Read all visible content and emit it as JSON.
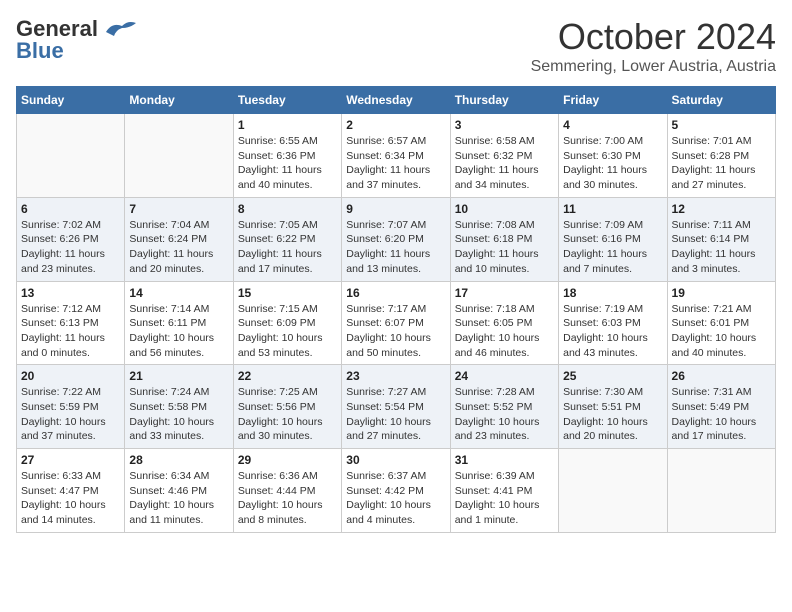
{
  "header": {
    "logo_line1": "General",
    "logo_line2": "Blue",
    "title": "October 2024",
    "subtitle": "Semmering, Lower Austria, Austria"
  },
  "weekdays": [
    "Sunday",
    "Monday",
    "Tuesday",
    "Wednesday",
    "Thursday",
    "Friday",
    "Saturday"
  ],
  "weeks": [
    [
      {
        "day": "",
        "info": ""
      },
      {
        "day": "",
        "info": ""
      },
      {
        "day": "1",
        "info": "Sunrise: 6:55 AM\nSunset: 6:36 PM\nDaylight: 11 hours and 40 minutes."
      },
      {
        "day": "2",
        "info": "Sunrise: 6:57 AM\nSunset: 6:34 PM\nDaylight: 11 hours and 37 minutes."
      },
      {
        "day": "3",
        "info": "Sunrise: 6:58 AM\nSunset: 6:32 PM\nDaylight: 11 hours and 34 minutes."
      },
      {
        "day": "4",
        "info": "Sunrise: 7:00 AM\nSunset: 6:30 PM\nDaylight: 11 hours and 30 minutes."
      },
      {
        "day": "5",
        "info": "Sunrise: 7:01 AM\nSunset: 6:28 PM\nDaylight: 11 hours and 27 minutes."
      }
    ],
    [
      {
        "day": "6",
        "info": "Sunrise: 7:02 AM\nSunset: 6:26 PM\nDaylight: 11 hours and 23 minutes."
      },
      {
        "day": "7",
        "info": "Sunrise: 7:04 AM\nSunset: 6:24 PM\nDaylight: 11 hours and 20 minutes."
      },
      {
        "day": "8",
        "info": "Sunrise: 7:05 AM\nSunset: 6:22 PM\nDaylight: 11 hours and 17 minutes."
      },
      {
        "day": "9",
        "info": "Sunrise: 7:07 AM\nSunset: 6:20 PM\nDaylight: 11 hours and 13 minutes."
      },
      {
        "day": "10",
        "info": "Sunrise: 7:08 AM\nSunset: 6:18 PM\nDaylight: 11 hours and 10 minutes."
      },
      {
        "day": "11",
        "info": "Sunrise: 7:09 AM\nSunset: 6:16 PM\nDaylight: 11 hours and 7 minutes."
      },
      {
        "day": "12",
        "info": "Sunrise: 7:11 AM\nSunset: 6:14 PM\nDaylight: 11 hours and 3 minutes."
      }
    ],
    [
      {
        "day": "13",
        "info": "Sunrise: 7:12 AM\nSunset: 6:13 PM\nDaylight: 11 hours and 0 minutes."
      },
      {
        "day": "14",
        "info": "Sunrise: 7:14 AM\nSunset: 6:11 PM\nDaylight: 10 hours and 56 minutes."
      },
      {
        "day": "15",
        "info": "Sunrise: 7:15 AM\nSunset: 6:09 PM\nDaylight: 10 hours and 53 minutes."
      },
      {
        "day": "16",
        "info": "Sunrise: 7:17 AM\nSunset: 6:07 PM\nDaylight: 10 hours and 50 minutes."
      },
      {
        "day": "17",
        "info": "Sunrise: 7:18 AM\nSunset: 6:05 PM\nDaylight: 10 hours and 46 minutes."
      },
      {
        "day": "18",
        "info": "Sunrise: 7:19 AM\nSunset: 6:03 PM\nDaylight: 10 hours and 43 minutes."
      },
      {
        "day": "19",
        "info": "Sunrise: 7:21 AM\nSunset: 6:01 PM\nDaylight: 10 hours and 40 minutes."
      }
    ],
    [
      {
        "day": "20",
        "info": "Sunrise: 7:22 AM\nSunset: 5:59 PM\nDaylight: 10 hours and 37 minutes."
      },
      {
        "day": "21",
        "info": "Sunrise: 7:24 AM\nSunset: 5:58 PM\nDaylight: 10 hours and 33 minutes."
      },
      {
        "day": "22",
        "info": "Sunrise: 7:25 AM\nSunset: 5:56 PM\nDaylight: 10 hours and 30 minutes."
      },
      {
        "day": "23",
        "info": "Sunrise: 7:27 AM\nSunset: 5:54 PM\nDaylight: 10 hours and 27 minutes."
      },
      {
        "day": "24",
        "info": "Sunrise: 7:28 AM\nSunset: 5:52 PM\nDaylight: 10 hours and 23 minutes."
      },
      {
        "day": "25",
        "info": "Sunrise: 7:30 AM\nSunset: 5:51 PM\nDaylight: 10 hours and 20 minutes."
      },
      {
        "day": "26",
        "info": "Sunrise: 7:31 AM\nSunset: 5:49 PM\nDaylight: 10 hours and 17 minutes."
      }
    ],
    [
      {
        "day": "27",
        "info": "Sunrise: 6:33 AM\nSunset: 4:47 PM\nDaylight: 10 hours and 14 minutes."
      },
      {
        "day": "28",
        "info": "Sunrise: 6:34 AM\nSunset: 4:46 PM\nDaylight: 10 hours and 11 minutes."
      },
      {
        "day": "29",
        "info": "Sunrise: 6:36 AM\nSunset: 4:44 PM\nDaylight: 10 hours and 8 minutes."
      },
      {
        "day": "30",
        "info": "Sunrise: 6:37 AM\nSunset: 4:42 PM\nDaylight: 10 hours and 4 minutes."
      },
      {
        "day": "31",
        "info": "Sunrise: 6:39 AM\nSunset: 4:41 PM\nDaylight: 10 hours and 1 minute."
      },
      {
        "day": "",
        "info": ""
      },
      {
        "day": "",
        "info": ""
      }
    ]
  ]
}
